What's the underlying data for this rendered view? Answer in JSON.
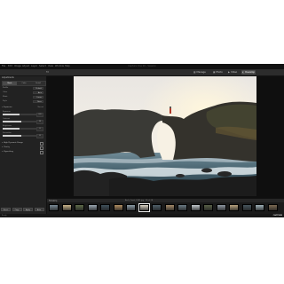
{
  "app": {
    "title": "Capture One 20 - Session"
  },
  "menu": [
    "File",
    "Edit",
    "Image",
    "Adjust",
    "Layer",
    "Select",
    "View",
    "Window",
    "Help"
  ],
  "toolbar": {
    "zoom": "Fit",
    "modules": [
      {
        "label": "Manage",
        "icon": "grid-icon",
        "active": false
      },
      {
        "label": "Photo",
        "icon": "photo-icon",
        "active": false
      },
      {
        "label": "Video",
        "icon": "video-icon",
        "active": false
      },
      {
        "label": "Develop",
        "icon": "develop-icon",
        "active": true
      }
    ]
  },
  "left_panel": {
    "title": "Adjustments",
    "segments": [
      "Basic",
      "Color",
      "Detail"
    ],
    "params": [
      {
        "label": "Profile",
        "value": "Default"
      },
      {
        "label": "Color",
        "value": "Auto"
      },
      {
        "label": "Mode",
        "value": "Linear"
      },
      {
        "label": "Style",
        "value": "None"
      }
    ],
    "exposure_header": "Exposure",
    "exposure_mode": "Manual",
    "sliders": [
      {
        "label": "Exposure",
        "value": "0.0",
        "level": 0.5
      },
      {
        "label": "Contrast",
        "value": "12",
        "level": 0.56
      },
      {
        "label": "Brightness",
        "value": "0",
        "level": 0.5
      },
      {
        "label": "Saturation",
        "value": "8",
        "level": 0.54
      }
    ],
    "sections": [
      "High Dynamic Range",
      "Clarity",
      "Vignetting"
    ],
    "buttons": [
      "Reset",
      "Copy",
      "Apply",
      "Auto"
    ]
  },
  "filmstrip": {
    "label": "Filmstrip",
    "info": "Arch_Coast_0141.jpg  ·  14 of 28",
    "count": 18,
    "selected_index": 7
  },
  "status": {
    "text": "Ready",
    "brand": "CAPTURE"
  },
  "colors": {
    "panel": "#222222",
    "accent": "#cfcfcf",
    "background": "#1e1e1e"
  }
}
